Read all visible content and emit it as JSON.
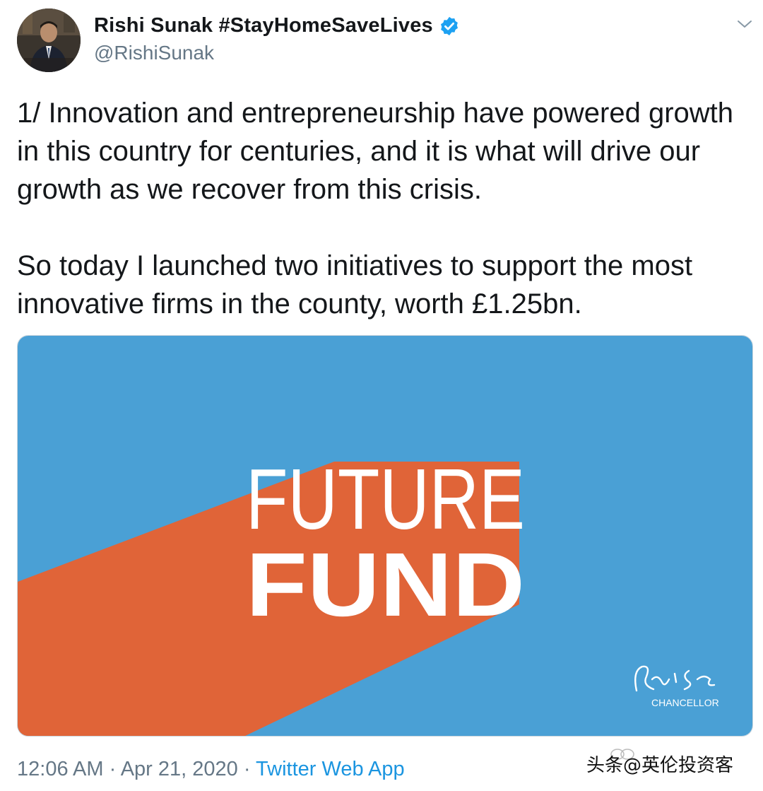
{
  "author": {
    "display_name": "Rishi Sunak #StayHomeSaveLives",
    "handle": "@RishiSunak",
    "verified": true
  },
  "tweet": {
    "paragraphs": [
      "1/ Innovation and entrepreneurship have powered growth in this country for centuries, and it is what will drive our growth as we recover from this crisis.",
      "So today I launched two initiatives to support the most innovative firms in the county, worth £1.25bn."
    ]
  },
  "media": {
    "headline_line1": "FUTURE",
    "headline_line2": "FUND",
    "signature": "Rishi Sunak",
    "signature_caption": "CHANCELLOR",
    "colors": {
      "background": "#4aa0d5",
      "stripe": "#e06438",
      "text": "#ffffff"
    }
  },
  "meta": {
    "time": "12:06 AM",
    "separator": " · ",
    "date": "Apr 21, 2020",
    "source": "Twitter Web App"
  },
  "watermark": {
    "text": "头条@英伦投资客"
  },
  "icons": {
    "verified": "verified-badge-icon",
    "menu": "chevron-down-icon"
  },
  "colors": {
    "accent": "#1da1f2",
    "link": "#1b95e0",
    "secondary_text": "#657786"
  }
}
